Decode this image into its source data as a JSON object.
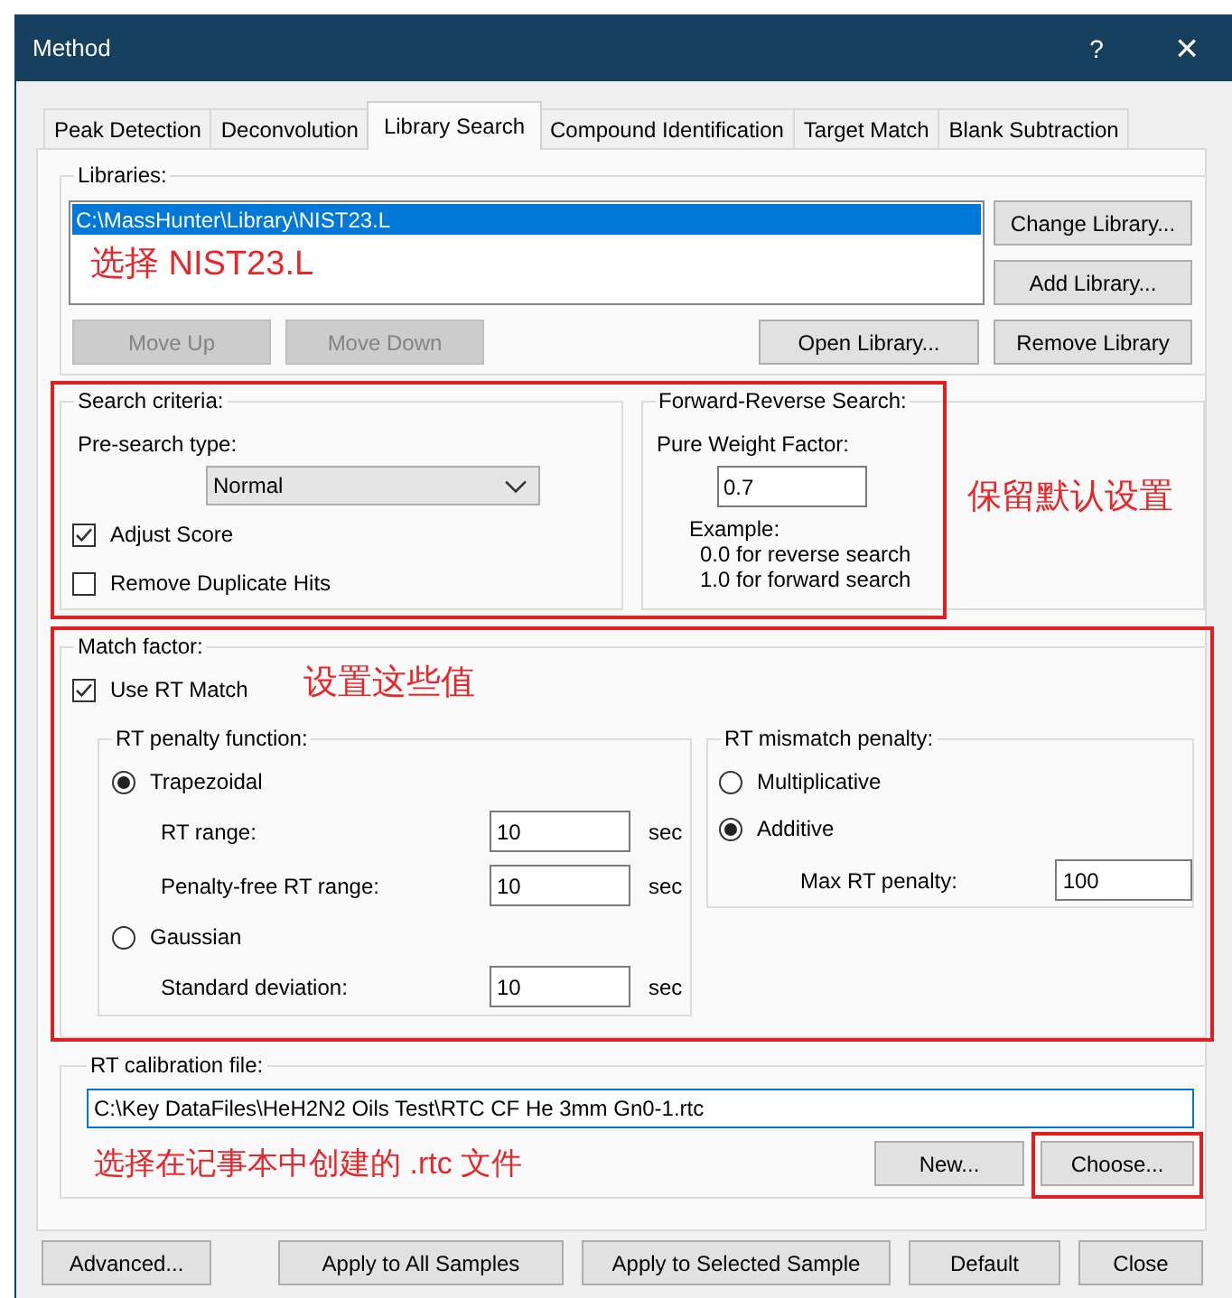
{
  "window": {
    "title": "Method",
    "help": "?",
    "close": "×"
  },
  "tabs": [
    {
      "label": "Peak Detection",
      "selected": false
    },
    {
      "label": "Deconvolution",
      "selected": false
    },
    {
      "label": "Library Search",
      "selected": true
    },
    {
      "label": "Compound Identification",
      "selected": false
    },
    {
      "label": "Target Match",
      "selected": false
    },
    {
      "label": "Blank Subtraction",
      "selected": false
    }
  ],
  "libraries": {
    "label": "Libraries:",
    "items": [
      {
        "path": "C:\\MassHunter\\Library\\NIST23.L",
        "selected": true
      }
    ],
    "annotation": "选择 NIST23.L",
    "buttons": [
      {
        "label": "Change Library...",
        "disabled": false
      },
      {
        "label": "Add Library...",
        "disabled": false
      },
      {
        "label": "Move Up",
        "disabled": true
      },
      {
        "label": "Move Down",
        "disabled": true
      },
      {
        "label": "Open Library...",
        "disabled": false
      },
      {
        "label": "Remove Library",
        "disabled": false
      }
    ]
  },
  "search_criteria": {
    "label": "Search criteria:",
    "presearch_label": "Pre-search type:",
    "presearch_value": "Normal",
    "options": [
      {
        "label": "Adjust Score",
        "checked": true
      },
      {
        "label": "Remove Duplicate Hits",
        "checked": false
      }
    ]
  },
  "forward_reverse": {
    "label": "Forward-Reverse Search:",
    "weight_label": "Pure Weight Factor:",
    "weight_value": "0.7",
    "example": [
      "Example:",
      "0.0 for reverse search",
      "1.0 for forward search"
    ],
    "annotation": "保留默认设置"
  },
  "match_factor": {
    "label": "Match factor:",
    "use_rt": {
      "label": "Use RT Match",
      "checked": true
    },
    "annotation": "设置这些值",
    "penalty_function": {
      "label": "RT penalty function:",
      "options": [
        {
          "label": "Trapezoidal",
          "selected": true,
          "fields": [
            {
              "label": "RT range:",
              "value": "10",
              "unit": "sec"
            },
            {
              "label": "Penalty-free RT range:",
              "value": "10",
              "unit": "sec"
            }
          ]
        },
        {
          "label": "Gaussian",
          "selected": false,
          "fields": [
            {
              "label": "Standard deviation:",
              "value": "10",
              "unit": "sec"
            }
          ]
        }
      ]
    },
    "mismatch": {
      "label": "RT mismatch penalty:",
      "options": [
        {
          "label": "Multiplicative",
          "selected": false
        },
        {
          "label": "Additive",
          "selected": true
        }
      ],
      "field": {
        "label": "Max RT penalty:",
        "value": "100"
      }
    }
  },
  "calibration": {
    "label": "RT calibration file:",
    "value": "C:\\Key DataFiles\\HeH2N2 Oils Test\\RTC CF He 3mm Gn0-1.rtc",
    "annotation": "选择在记事本中创建的 .rtc 文件",
    "buttons": [
      "New...",
      "Choose..."
    ]
  },
  "dialog_buttons": [
    "Advanced...",
    "Apply to All Samples",
    "Apply to Selected Sample",
    "Default",
    "Close"
  ]
}
